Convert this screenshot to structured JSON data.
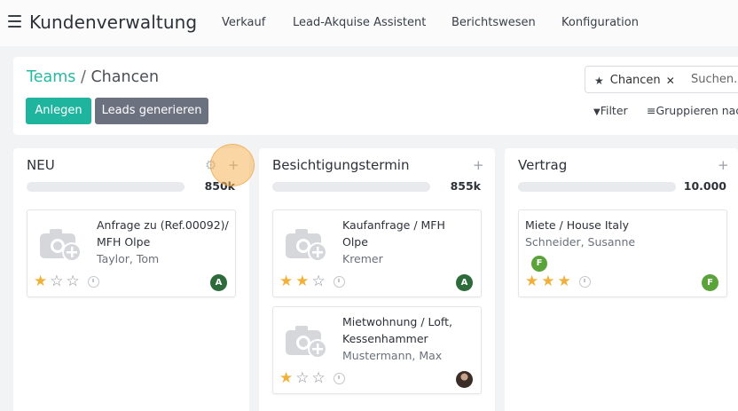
{
  "topnav": {
    "app_title": "Kundenverwaltung",
    "menu": [
      "Verkauf",
      "Lead-Akquise Assistent",
      "Berichtswesen",
      "Konfiguration"
    ]
  },
  "breadcrumb": {
    "parent": "Teams",
    "separator": "/",
    "current": "Chancen"
  },
  "buttons": {
    "create": "Anlegen",
    "generate_leads": "Leads generieren"
  },
  "search": {
    "facet_label": "Chancen",
    "placeholder": "Suchen..."
  },
  "toolbar": {
    "filter": "Filter",
    "group_by": "Gruppieren nach"
  },
  "columns": [
    {
      "title": "NEU",
      "sum": "850k",
      "cards": [
        {
          "title": "Anfrage zu (Ref.00092)/ MFH Olpe",
          "contact": "Taylor, Tom",
          "stars": 1,
          "avatar": "A"
        }
      ]
    },
    {
      "title": "Besichtigungstermin",
      "sum": "855k",
      "cards": [
        {
          "title": "Kaufanfrage / MFH Olpe",
          "contact": "Kremer",
          "stars": 2,
          "avatar": "A"
        },
        {
          "title": "Mietwohnung / Loft, Kessenhammer",
          "contact": "Mustermann, Max",
          "stars": 1,
          "avatar": ""
        }
      ]
    },
    {
      "title": "Vertrag",
      "sum": "10.000",
      "cards": [
        {
          "title": "Miete / House Italy",
          "contact": "Schneider, Susanne",
          "stars": 3,
          "avatar": "F",
          "tag": "F"
        }
      ]
    }
  ],
  "colors": {
    "accent": "#1eb49d",
    "secondary": "#6c7180",
    "star": "#f0b13b",
    "highlight": "#f5b45a"
  }
}
